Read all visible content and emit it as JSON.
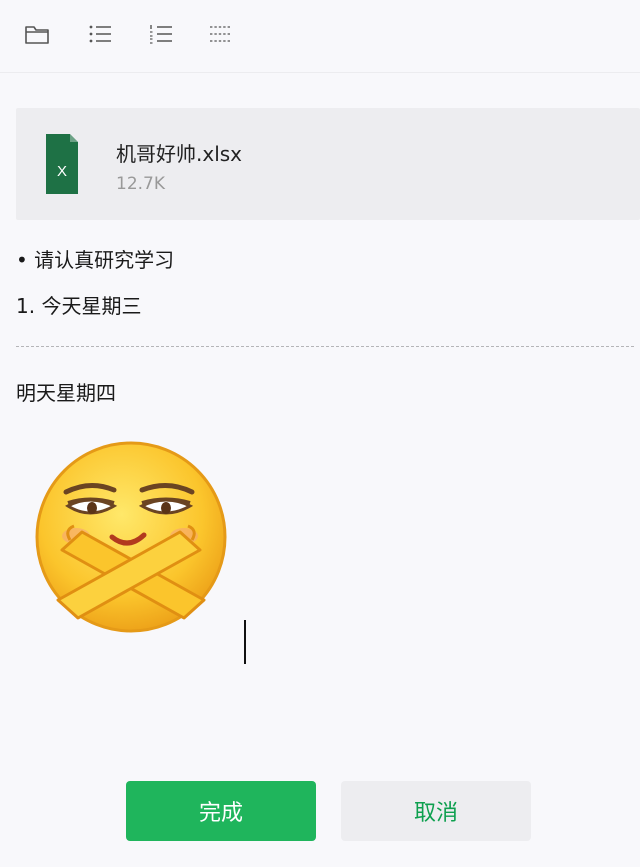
{
  "toolbar": {
    "items": [
      {
        "icon": "folder-icon"
      },
      {
        "icon": "bullet-list-icon"
      },
      {
        "icon": "numbered-list-icon"
      },
      {
        "icon": "divider-line-icon"
      }
    ]
  },
  "attachment": {
    "icon_letter": "X",
    "file_name": "机哥好帅.xlsx",
    "file_size": "12.7K",
    "icon_color": "#1e7145"
  },
  "content": {
    "bullet_item": "• 请认真研究学习",
    "numbered_item": "1. 今天星期三",
    "paragraph": "明天星期四",
    "sticker": "crossed-arms-emoji-sticker"
  },
  "buttons": {
    "done_label": "完成",
    "cancel_label": "取消"
  },
  "colors": {
    "accent": "#1fb55c",
    "cancel_text": "#0ea04f",
    "background": "#f8f8fb"
  }
}
